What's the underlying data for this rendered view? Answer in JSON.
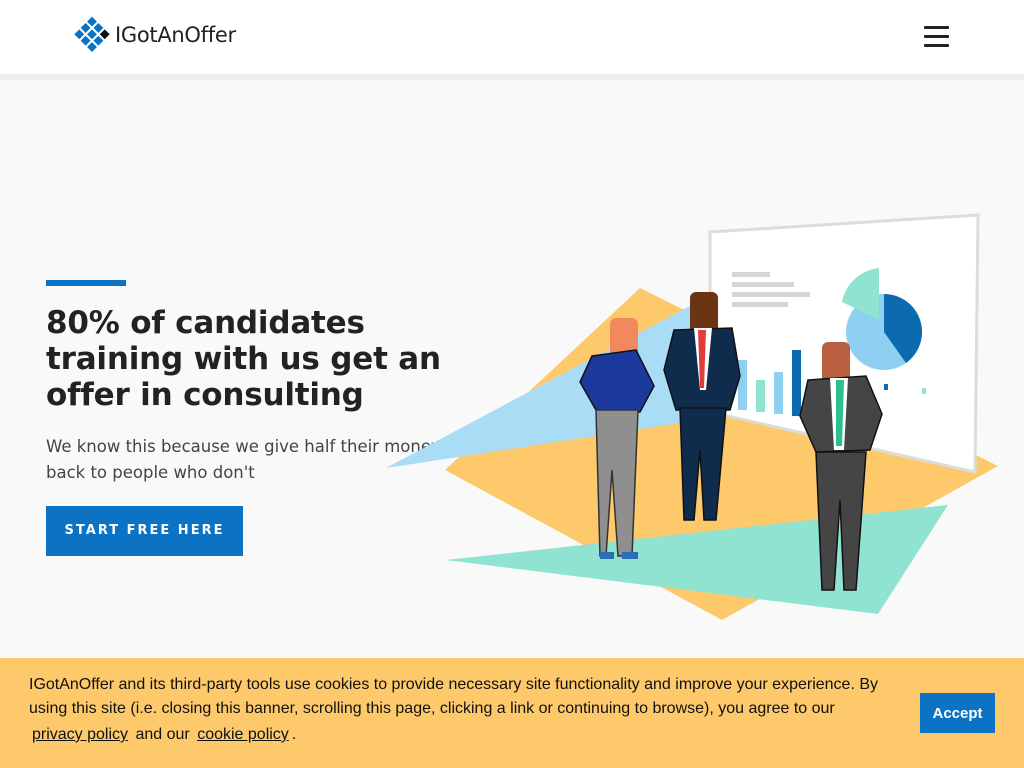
{
  "header": {
    "logo_text": "IGotAnOffer",
    "logo_icon": "diamond-grid-logo-icon",
    "menu_icon": "hamburger-menu-icon"
  },
  "hero": {
    "title": "80% of candidates training with us get an offer in consulting",
    "subtitle": "We know this because we give half their money back to people who don't",
    "cta_label": "START FREE HERE",
    "illustration": "consultants-presentation-illustration"
  },
  "cookie_banner": {
    "text": "IGotAnOffer and its third-party tools use cookies to provide necessary site functionality and improve your experience. By using this site (i.e. closing this banner, scrolling this page, clicking a link or continuing to browse), you agree to our",
    "privacy_link": "privacy policy",
    "and_text": "and our",
    "cookie_link": "cookie policy",
    "end_punct": ".",
    "accept_label": "Accept"
  },
  "colors": {
    "brand_blue": "#0b72c4",
    "banner_yellow": "#fdc96b",
    "background": "#f9f9f9"
  }
}
